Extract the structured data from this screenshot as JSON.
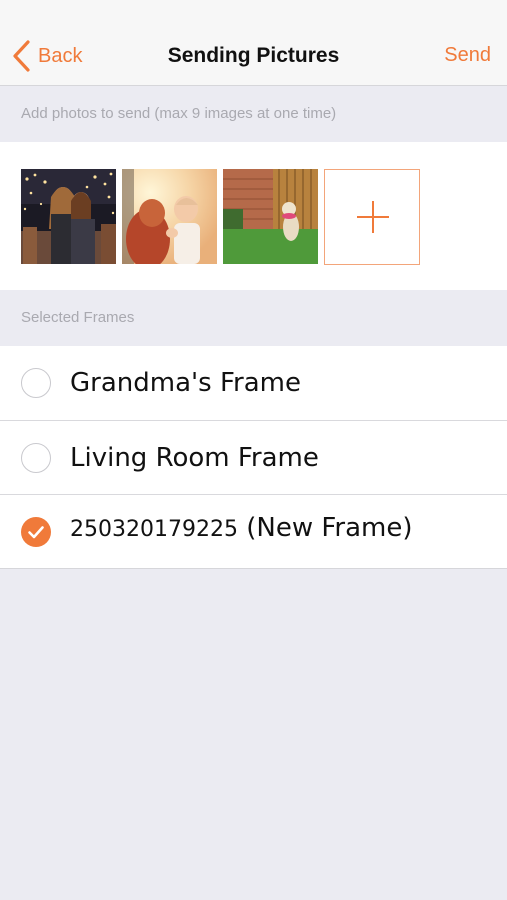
{
  "header": {
    "back_label": "Back",
    "title": "Sending Pictures",
    "send_label": "Send"
  },
  "photos_section": {
    "hint": "Add photos to send (max 9 images at one time)",
    "thumbnails": [
      "photo-two-girls-lights",
      "photo-baby-sunlight",
      "photo-puppy-lawn"
    ],
    "add_icon": "plus-icon"
  },
  "frames_section": {
    "header": "Selected Frames",
    "items": [
      {
        "label": "Grandma's Frame",
        "selected": false
      },
      {
        "label": "Living Room Frame",
        "selected": false
      },
      {
        "id": "250320179225",
        "suffix": " (New Frame)",
        "selected": true
      }
    ]
  },
  "colors": {
    "accent": "#f07a3a",
    "background": "#ebebf2",
    "section_text": "#a9a9b0"
  }
}
